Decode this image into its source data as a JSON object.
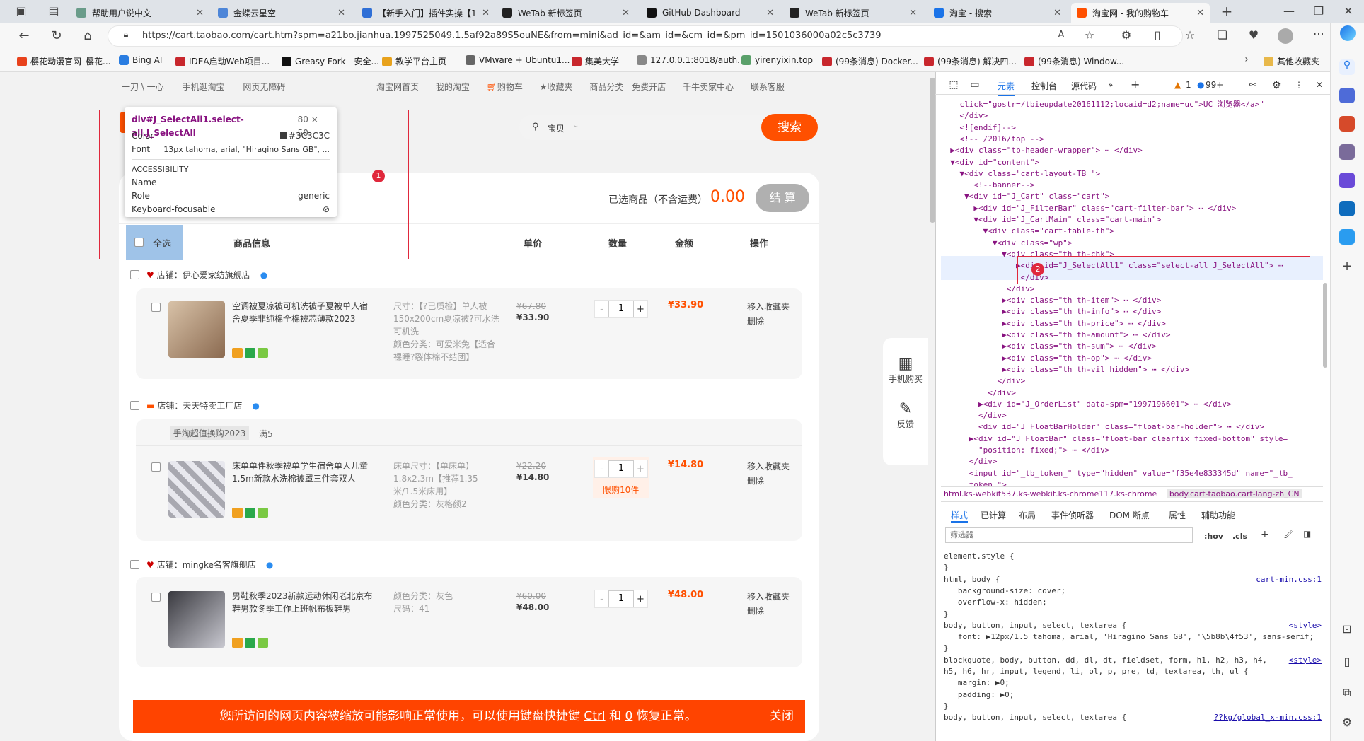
{
  "tabs": [
    {
      "label": "帮助用户说中文",
      "color": "#6a9c8a"
    },
    {
      "label": "金蝶云星空",
      "color": "#4e86d8"
    },
    {
      "label": "【新手入门】插件实操【1",
      "color": "#2f6fd6"
    },
    {
      "label": "WeTab 新标签页",
      "color": "#222222"
    },
    {
      "label": "GitHub Dashboard",
      "color": "#111111"
    },
    {
      "label": "WeTab 新标签页",
      "color": "#222222"
    },
    {
      "label": "淘宝 - 搜索",
      "color": "#1a73e8"
    },
    {
      "label": "淘宝网 - 我的购物车",
      "color": "#ff5000"
    }
  ],
  "url": "https://cart.taobao.com/cart.htm?spm=a21bo.jianhua.1997525049.1.5af92a89S5ouNE&from=mini&ad_id=&am_id=&cm_id=&pm_id=1501036000a02c5c3739",
  "favorites": [
    {
      "label": "樱花动漫官网_樱花...",
      "color": "#e8421c"
    },
    {
      "label": "Bing AI",
      "color": "#2a7de1"
    },
    {
      "label": "IDEA启动Web项目...",
      "color": "#c8272d"
    },
    {
      "label": "Greasy Fork - 安全...",
      "color": "#111111"
    },
    {
      "label": "教学平台主页",
      "color": "#e8a21c"
    },
    {
      "label": "VMware + Ubuntu1...",
      "color": "#666666"
    },
    {
      "label": "集美大学",
      "color": "#c8272d"
    },
    {
      "label": "127.0.0.1:8018/auth...",
      "color": "#888888"
    },
    {
      "label": "yirenyixin.top",
      "color": "#5aa06a"
    },
    {
      "label": "(99条消息) Docker...",
      "color": "#c8272d"
    },
    {
      "label": "(99条消息) 解决四...",
      "color": "#c8272d"
    },
    {
      "label": "(99条消息) Window...",
      "color": "#c8272d"
    }
  ],
  "other_favorites": "其他收藏夹",
  "topnav": {
    "left": [
      "一刀 \\ 一心",
      "手机逛淘宝",
      "网页无障碍"
    ],
    "right": [
      "淘宝网首页",
      "我的淘宝",
      "购物车",
      "收藏夹",
      "商品分类",
      "免费开店",
      "千牛卖家中心",
      "联系客服"
    ]
  },
  "search": {
    "scope": "宝贝",
    "button": "搜索"
  },
  "summary": {
    "label": "已选商品（不含运费）",
    "amount": "0.00",
    "checkout": "结 算"
  },
  "header": {
    "select_all": "全选",
    "info": "商品信息",
    "price": "单价",
    "qty": "数量",
    "amount": "金额",
    "op": "操作"
  },
  "shops": [
    {
      "name": "店铺：伊心爱家纺旗舰店"
    },
    {
      "name": "店铺：天天特卖工厂店",
      "promo_tag": "手淘超值换购2023",
      "promo_text": "满5"
    },
    {
      "name": "店铺：mingke名客旗舰店"
    }
  ],
  "items": [
    {
      "title": "空调被夏凉被可机洗被子夏被单人宿舍夏季非纯棉全棉被芯薄款2023",
      "sku": "尺寸：【?已质检】单人被150x200cm夏凉被?可水洗可机洗\n颜色分类：可爱米兔【适合裸睡?裂体棉不结团】",
      "old_price": "¥67.80",
      "price": "¥33.90",
      "qty": "1",
      "sum": "¥33.90",
      "ops": [
        "移入收藏夹",
        "删除"
      ],
      "limit": ""
    },
    {
      "title": "床单单件秋季被单学生宿舍单人儿童1.5m新款水洗棉被罩三件套双人",
      "sku": "床单尺寸：【单床单】1.8x2.3m【推荐1.35米/1.5米床用】\n颜色分类：灰格颜2",
      "old_price": "¥22.20",
      "price": "¥14.80",
      "qty": "1",
      "sum": "¥14.80",
      "ops": [
        "移入收藏夹",
        "删除"
      ],
      "limit": "限购10件"
    },
    {
      "title": "男鞋秋季2023新款运动休闲老北京布鞋男款冬季工作上班帆布板鞋男",
      "sku": "颜色分类：灰色\n尺码：41",
      "old_price": "¥60.00",
      "price": "¥48.00",
      "qty": "1",
      "sum": "¥48.00",
      "ops": [
        "移入收藏夹",
        "删除"
      ],
      "limit": ""
    }
  ],
  "float_bar": {
    "mobile": "手机购买",
    "feedback": "反馈"
  },
  "zoom_banner": {
    "text_before": "您所访问的网页内容被缩放可能影响正常使用，可以使用键盘快捷键 ",
    "key1": "Ctrl",
    "mid": " 和 ",
    "key2": "0",
    "after": " 恢复正常。",
    "close": "关闭"
  },
  "tooltip": {
    "selector": "div#J_SelectAll1.select-all.J_SelectAll",
    "size": "80 × 50",
    "color_label": "Color",
    "color_value": "#3C3C3C",
    "font_label": "Font",
    "font_value": "13px tahoma, arial, \"Hiragino Sans GB\", ...",
    "accessibility": "ACCESSIBILITY",
    "name_label": "Name",
    "role_label": "Role",
    "role_value": "generic",
    "kb_label": "Keyboard-focusable"
  },
  "markers": [
    "1",
    "2"
  ],
  "devtools": {
    "tabs": [
      "元素",
      "控制台",
      "源代码"
    ],
    "warn_count": "1",
    "info_count": "99+",
    "code_lines": [
      "    click=\"gostr=/tbieupdate20161112;locaid=d2;name=uc\">UC 浏览器</a>\"",
      "    </div>",
      "    <![endif]-->",
      "    <!-- /2016/top -->",
      "  ▶<div class=\"tb-header-wrapper\"> ⋯ </div>",
      "  ▼<div id=\"content\">",
      "    ▼<div class=\"cart-layout-TB \">",
      "       <!--banner-->",
      "     ▼<div id=\"J_Cart\" class=\"cart\">",
      "       ▶<div id=\"J_FilterBar\" class=\"cart-filter-bar\"> ⋯ </div>",
      "       ▼<div id=\"J_CartMain\" class=\"cart-main\">",
      "         ▼<div class=\"cart-table-th\">",
      "           ▼<div class=\"wp\">",
      "             ▼<div class=\"th th-chk\">",
      "                ▶<div id=\"J_SelectAll1\" class=\"select-all J_SelectAll\"> ⋯",
      "                 </div>",
      "              </div>",
      "             ▶<div class=\"th th-item\"> ⋯ </div>",
      "             ▶<div class=\"th th-info\"> ⋯ </div>",
      "             ▶<div class=\"th th-price\"> ⋯ </div>",
      "             ▶<div class=\"th th-amount\"> ⋯ </div>",
      "             ▶<div class=\"th th-sum\"> ⋯ </div>",
      "             ▶<div class=\"th th-op\"> ⋯ </div>",
      "             ▶<div class=\"th th-vil hidden\"> ⋯ </div>",
      "            </div>",
      "          </div>",
      "        ▶<div id=\"J_OrderList\" data-spm=\"1997196601\"> ⋯ </div>",
      "        </div>",
      "        <div id=\"J_FloatBarHolder\" class=\"float-bar-holder\"> ⋯ </div>",
      "      ▶<div id=\"J_FloatBar\" class=\"float-bar clearfix fixed-bottom\" style=",
      "        \"position: fixed;\"> ⋯ </div>",
      "      </div>",
      "      <input id=\"_tb_token_\" type=\"hidden\" value=\"f35e4e833345d\" name=\"_tb_",
      "      token_\">"
    ],
    "breadcrumb": [
      "html.ks-webkit537.ks-webkit.ks-chrome117.ks-chrome",
      "body.cart-taobao.cart-lang-zh_CN"
    ],
    "style_tabs": [
      "样式",
      "已计算",
      "布局",
      "事件侦听器",
      "DOM 断点",
      "属性",
      "辅助功能"
    ],
    "filter_placeholder": "筛选器",
    "hov": ":hov",
    "cls": ".cls",
    "styles": [
      {
        "sel": "element.style {",
        "src": ""
      },
      {
        "sel": "}",
        "src": ""
      },
      {
        "sel": "html, body {",
        "src": "cart-min.css:1"
      },
      {
        "sel": "   background-size: cover;",
        "src": ""
      },
      {
        "sel": "   overflow-x: hidden;",
        "src": ""
      },
      {
        "sel": "}",
        "src": ""
      },
      {
        "sel": "body, button, input, select, textarea {",
        "src": "<style>"
      },
      {
        "sel": "   font: ▶12px/1.5 tahoma, arial, 'Hiragino Sans GB', '\\5b8b\\4f53', sans-serif;",
        "src": ""
      },
      {
        "sel": "}",
        "src": ""
      },
      {
        "sel": "blockquote, body, button, dd, dl, dt, fieldset, form, h1, h2, h3, h4,",
        "src": "<style>"
      },
      {
        "sel": "h5, h6, hr, input, legend, li, ol, p, pre, td, textarea, th, ul {",
        "src": ""
      },
      {
        "sel": "   margin: ▶0;",
        "src": ""
      },
      {
        "sel": "   padding: ▶0;",
        "src": ""
      },
      {
        "sel": "}",
        "src": ""
      },
      {
        "sel": "body, button, input, select, textarea {",
        "src": "??kg/global_x-min.css:1"
      }
    ]
  }
}
